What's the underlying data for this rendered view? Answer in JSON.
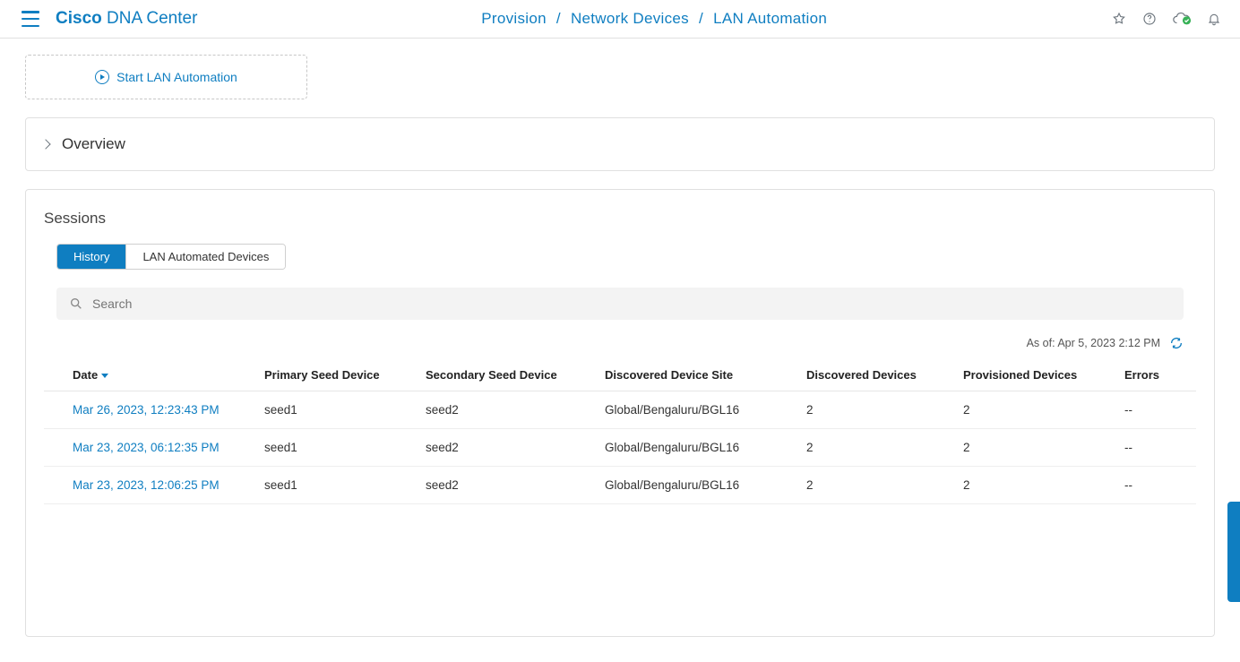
{
  "header": {
    "app_bold": "Cisco",
    "app_light": " DNA Center",
    "breadcrumb": [
      "Provision",
      "Network Devices",
      "LAN Automation"
    ]
  },
  "start": {
    "label": "Start LAN Automation"
  },
  "overview": {
    "title": "Overview"
  },
  "sessions": {
    "title": "Sessions",
    "tabs": [
      "History",
      "LAN Automated Devices"
    ],
    "active_tab": 0,
    "search_placeholder": "Search",
    "timestamp_prefix": "As of: ",
    "timestamp_value": "Apr 5, 2023 2:12 PM",
    "columns": [
      "Date",
      "Primary Seed Device",
      "Secondary Seed Device",
      "Discovered Device Site",
      "Discovered Devices",
      "Provisioned Devices",
      "Errors"
    ],
    "sorted_column": 0,
    "rows": [
      {
        "date": "Mar 26, 2023, 12:23:43 PM",
        "primary": "seed1",
        "secondary": "seed2",
        "site": "Global/Bengaluru/BGL16",
        "discovered": "2",
        "provisioned": "2",
        "errors": "--"
      },
      {
        "date": "Mar 23, 2023, 06:12:35 PM",
        "primary": "seed1",
        "secondary": "seed2",
        "site": "Global/Bengaluru/BGL16",
        "discovered": "2",
        "provisioned": "2",
        "errors": "--"
      },
      {
        "date": "Mar 23, 2023, 12:06:25 PM",
        "primary": "seed1",
        "secondary": "seed2",
        "site": "Global/Bengaluru/BGL16",
        "discovered": "2",
        "provisioned": "2",
        "errors": "--"
      }
    ]
  }
}
